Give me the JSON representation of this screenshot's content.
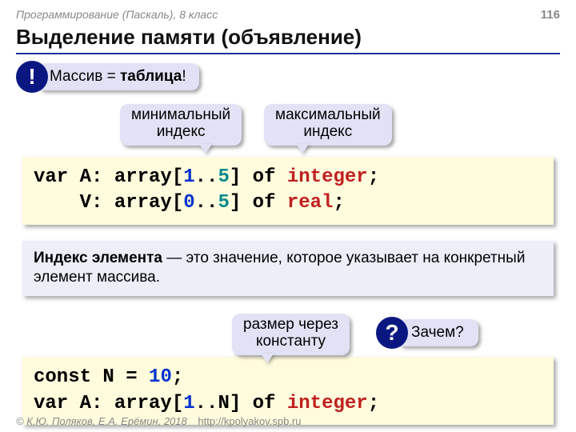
{
  "header": {
    "course": "Программирование (Паскаль), 8 класс",
    "page": "116"
  },
  "title": "Выделение памяти (объявление)",
  "bang": {
    "mark": "!",
    "text_plain": "Массив = ",
    "text_bold": "таблица",
    "text_end": "!"
  },
  "labels": {
    "min": {
      "l1": "минимальный",
      "l2": "индекс"
    },
    "max": {
      "l1": "максимальный",
      "l2": "индекс"
    }
  },
  "code1": {
    "l1": {
      "p1": "var A: array[",
      "i1": "1",
      "p2": "..",
      "i2": "5",
      "p3": "] of ",
      "type": "integer",
      "p4": ";"
    },
    "l2": {
      "p0": "    V: array[",
      "i1": "0",
      "p2": "..",
      "i2": "5",
      "p3": "] of ",
      "type": "real",
      "p4": ";"
    }
  },
  "definition": {
    "bold": "Индекс элемента",
    "rest": " — это значение, которое указывает на конкретный элемент массива."
  },
  "row2": {
    "size_label": {
      "l1": "размер через",
      "l2": "константу"
    },
    "qmark": "?",
    "why": "Зачем?"
  },
  "code2": {
    "l1": {
      "p1": "const N",
      "eq": " = ",
      "n": "10",
      "p2": ";"
    },
    "l2": {
      "p1": "var A: array[",
      "i1": "1",
      "p2": "..N] of ",
      "type": "integer",
      "p3": ";"
    }
  },
  "footer": {
    "copyright": "© К.Ю. Поляков, Е.А. Ерёмин, 2018",
    "url": "http://kpolyakov.spb.ru"
  }
}
